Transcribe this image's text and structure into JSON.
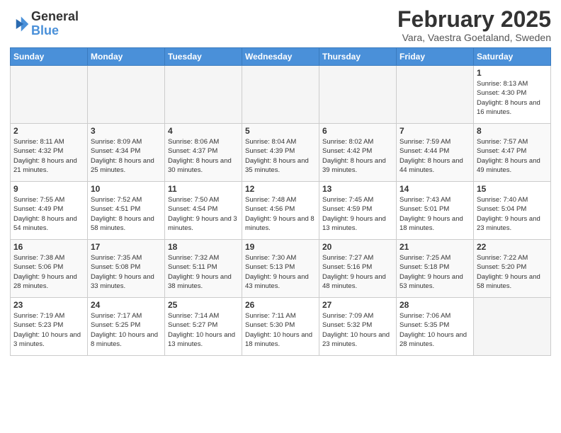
{
  "header": {
    "logo_line1": "General",
    "logo_line2": "Blue",
    "month_title": "February 2025",
    "location": "Vara, Vaestra Goetaland, Sweden"
  },
  "weekdays": [
    "Sunday",
    "Monday",
    "Tuesday",
    "Wednesday",
    "Thursday",
    "Friday",
    "Saturday"
  ],
  "weeks": [
    [
      {
        "day": "",
        "info": ""
      },
      {
        "day": "",
        "info": ""
      },
      {
        "day": "",
        "info": ""
      },
      {
        "day": "",
        "info": ""
      },
      {
        "day": "",
        "info": ""
      },
      {
        "day": "",
        "info": ""
      },
      {
        "day": "1",
        "info": "Sunrise: 8:13 AM\nSunset: 4:30 PM\nDaylight: 8 hours and 16 minutes."
      }
    ],
    [
      {
        "day": "2",
        "info": "Sunrise: 8:11 AM\nSunset: 4:32 PM\nDaylight: 8 hours and 21 minutes."
      },
      {
        "day": "3",
        "info": "Sunrise: 8:09 AM\nSunset: 4:34 PM\nDaylight: 8 hours and 25 minutes."
      },
      {
        "day": "4",
        "info": "Sunrise: 8:06 AM\nSunset: 4:37 PM\nDaylight: 8 hours and 30 minutes."
      },
      {
        "day": "5",
        "info": "Sunrise: 8:04 AM\nSunset: 4:39 PM\nDaylight: 8 hours and 35 minutes."
      },
      {
        "day": "6",
        "info": "Sunrise: 8:02 AM\nSunset: 4:42 PM\nDaylight: 8 hours and 39 minutes."
      },
      {
        "day": "7",
        "info": "Sunrise: 7:59 AM\nSunset: 4:44 PM\nDaylight: 8 hours and 44 minutes."
      },
      {
        "day": "8",
        "info": "Sunrise: 7:57 AM\nSunset: 4:47 PM\nDaylight: 8 hours and 49 minutes."
      }
    ],
    [
      {
        "day": "9",
        "info": "Sunrise: 7:55 AM\nSunset: 4:49 PM\nDaylight: 8 hours and 54 minutes."
      },
      {
        "day": "10",
        "info": "Sunrise: 7:52 AM\nSunset: 4:51 PM\nDaylight: 8 hours and 58 minutes."
      },
      {
        "day": "11",
        "info": "Sunrise: 7:50 AM\nSunset: 4:54 PM\nDaylight: 9 hours and 3 minutes."
      },
      {
        "day": "12",
        "info": "Sunrise: 7:48 AM\nSunset: 4:56 PM\nDaylight: 9 hours and 8 minutes."
      },
      {
        "day": "13",
        "info": "Sunrise: 7:45 AM\nSunset: 4:59 PM\nDaylight: 9 hours and 13 minutes."
      },
      {
        "day": "14",
        "info": "Sunrise: 7:43 AM\nSunset: 5:01 PM\nDaylight: 9 hours and 18 minutes."
      },
      {
        "day": "15",
        "info": "Sunrise: 7:40 AM\nSunset: 5:04 PM\nDaylight: 9 hours and 23 minutes."
      }
    ],
    [
      {
        "day": "16",
        "info": "Sunrise: 7:38 AM\nSunset: 5:06 PM\nDaylight: 9 hours and 28 minutes."
      },
      {
        "day": "17",
        "info": "Sunrise: 7:35 AM\nSunset: 5:08 PM\nDaylight: 9 hours and 33 minutes."
      },
      {
        "day": "18",
        "info": "Sunrise: 7:32 AM\nSunset: 5:11 PM\nDaylight: 9 hours and 38 minutes."
      },
      {
        "day": "19",
        "info": "Sunrise: 7:30 AM\nSunset: 5:13 PM\nDaylight: 9 hours and 43 minutes."
      },
      {
        "day": "20",
        "info": "Sunrise: 7:27 AM\nSunset: 5:16 PM\nDaylight: 9 hours and 48 minutes."
      },
      {
        "day": "21",
        "info": "Sunrise: 7:25 AM\nSunset: 5:18 PM\nDaylight: 9 hours and 53 minutes."
      },
      {
        "day": "22",
        "info": "Sunrise: 7:22 AM\nSunset: 5:20 PM\nDaylight: 9 hours and 58 minutes."
      }
    ],
    [
      {
        "day": "23",
        "info": "Sunrise: 7:19 AM\nSunset: 5:23 PM\nDaylight: 10 hours and 3 minutes."
      },
      {
        "day": "24",
        "info": "Sunrise: 7:17 AM\nSunset: 5:25 PM\nDaylight: 10 hours and 8 minutes."
      },
      {
        "day": "25",
        "info": "Sunrise: 7:14 AM\nSunset: 5:27 PM\nDaylight: 10 hours and 13 minutes."
      },
      {
        "day": "26",
        "info": "Sunrise: 7:11 AM\nSunset: 5:30 PM\nDaylight: 10 hours and 18 minutes."
      },
      {
        "day": "27",
        "info": "Sunrise: 7:09 AM\nSunset: 5:32 PM\nDaylight: 10 hours and 23 minutes."
      },
      {
        "day": "28",
        "info": "Sunrise: 7:06 AM\nSunset: 5:35 PM\nDaylight: 10 hours and 28 minutes."
      },
      {
        "day": "",
        "info": ""
      }
    ]
  ]
}
